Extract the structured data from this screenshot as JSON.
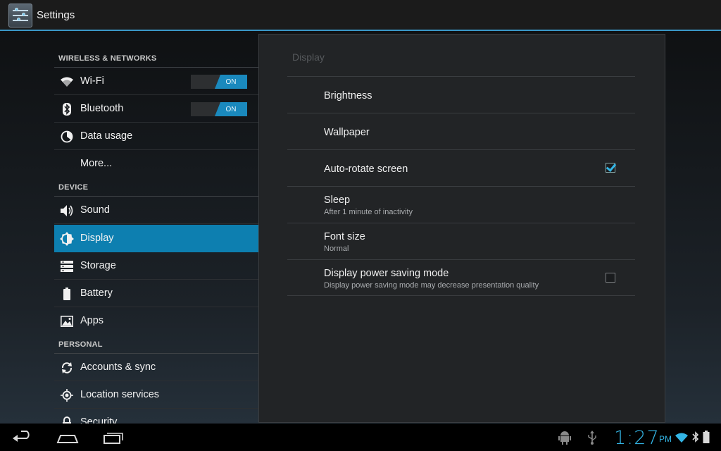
{
  "app": {
    "title": "Settings"
  },
  "sidebar": {
    "sections": [
      {
        "header": "WIRELESS & NETWORKS"
      },
      {
        "header": "DEVICE"
      },
      {
        "header": "PERSONAL"
      }
    ],
    "items": [
      {
        "label": "Wi-Fi",
        "icon": "wifi-icon",
        "toggle": "ON"
      },
      {
        "label": "Bluetooth",
        "icon": "bluetooth-icon",
        "toggle": "ON"
      },
      {
        "label": "Data usage",
        "icon": "data-usage-icon"
      },
      {
        "label": "More..."
      },
      {
        "label": "Sound",
        "icon": "speaker-icon"
      },
      {
        "label": "Display",
        "icon": "brightness-icon",
        "selected": true
      },
      {
        "label": "Storage",
        "icon": "storage-icon"
      },
      {
        "label": "Battery",
        "icon": "battery-icon"
      },
      {
        "label": "Apps",
        "icon": "apps-icon"
      },
      {
        "label": "Accounts & sync",
        "icon": "sync-icon"
      },
      {
        "label": "Location services",
        "icon": "location-icon"
      },
      {
        "label": "Security",
        "icon": "lock-icon"
      }
    ]
  },
  "detail": {
    "title": "Display",
    "rows": [
      {
        "title": "Brightness"
      },
      {
        "title": "Wallpaper"
      },
      {
        "title": "Auto-rotate screen",
        "checkbox": true
      },
      {
        "title": "Sleep",
        "summary": "After 1 minute of inactivity"
      },
      {
        "title": "Font size",
        "summary": "Normal"
      },
      {
        "title": "Display power saving mode",
        "summary": "Display power saving mode may decrease presentation quality",
        "checkbox": false
      }
    ]
  },
  "statusbar": {
    "time": "1:27",
    "ampm": "PM"
  },
  "colors": {
    "accent": "#33b5e5",
    "selected": "#0d7fb0"
  }
}
